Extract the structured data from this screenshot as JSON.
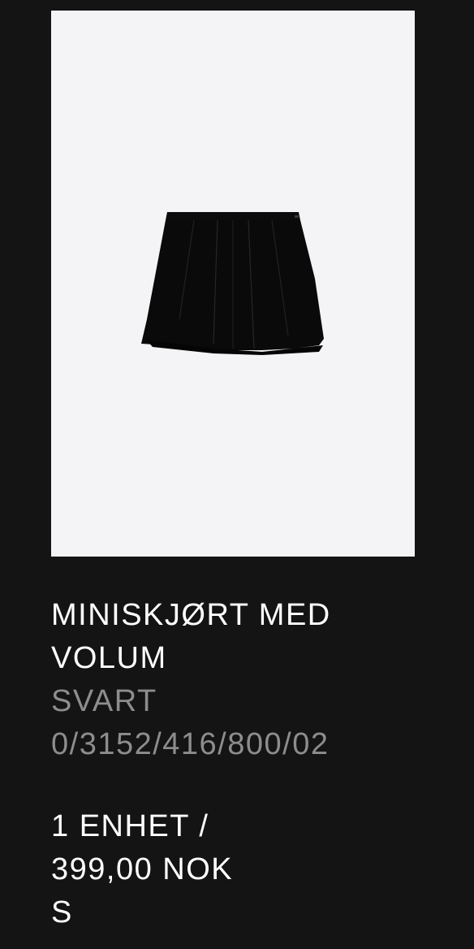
{
  "product": {
    "image_alt": "Black pleated mini skirt",
    "title_line1": "MINISKJØRT MED",
    "title_line2": "VOLUM",
    "color": "SVART",
    "reference": "0/3152/416/800/02",
    "quantity_line": "1 ENHET /",
    "price": "399,00 NOK",
    "size": "S"
  },
  "colors": {
    "background": "#141414",
    "image_background": "#f4f4f7",
    "text_primary": "#ffffff",
    "text_secondary": "#8d8d8d",
    "skirt": "#0a0a0a"
  }
}
